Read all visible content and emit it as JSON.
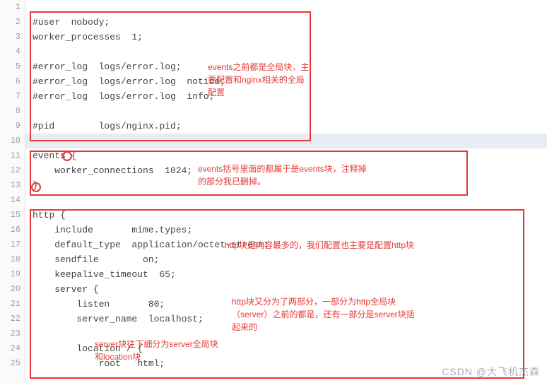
{
  "code_lines": [
    {
      "n": 1,
      "text": "",
      "hl": false
    },
    {
      "n": 2,
      "text": "#user  nobody;",
      "hl": false
    },
    {
      "n": 3,
      "text": "worker_processes  1;",
      "hl": false
    },
    {
      "n": 4,
      "text": "",
      "hl": false
    },
    {
      "n": 5,
      "text": "#error_log  logs/error.log;",
      "hl": false
    },
    {
      "n": 6,
      "text": "#error_log  logs/error.log  notice;",
      "hl": false
    },
    {
      "n": 7,
      "text": "#error_log  logs/error.log  info;",
      "hl": false
    },
    {
      "n": 8,
      "text": "",
      "hl": false
    },
    {
      "n": 9,
      "text": "#pid        logs/nginx.pid;",
      "hl": false
    },
    {
      "n": 10,
      "text": "",
      "hl": true
    },
    {
      "n": 11,
      "text": "events {",
      "hl": false
    },
    {
      "n": 12,
      "text": "    worker_connections  1024;",
      "hl": false
    },
    {
      "n": 13,
      "text": "}",
      "hl": false
    },
    {
      "n": 14,
      "text": "",
      "hl": false
    },
    {
      "n": 15,
      "text": "http {",
      "hl": false
    },
    {
      "n": 16,
      "text": "    include       mime.types;",
      "hl": false
    },
    {
      "n": 17,
      "text": "    default_type  application/octet-stream;",
      "hl": false
    },
    {
      "n": 18,
      "text": "    sendfile        on;",
      "hl": false
    },
    {
      "n": 19,
      "text": "    keepalive_timeout  65;",
      "hl": false
    },
    {
      "n": 20,
      "text": "    server {",
      "hl": false
    },
    {
      "n": 21,
      "text": "        listen       80;",
      "hl": false
    },
    {
      "n": 22,
      "text": "        server_name  localhost;",
      "hl": false
    },
    {
      "n": 23,
      "text": "",
      "hl": false
    },
    {
      "n": 24,
      "text": "        location / {",
      "hl": false
    },
    {
      "n": 25,
      "text": "            root   html;",
      "hl": false
    }
  ],
  "annotations": {
    "global_block": "events之前都是全局块，主要配置和nginx相关的全局配置",
    "events_block": "events括号里面的都属于是events块，注释掉的部分我已删掉。",
    "http_block": "http块是内容最多的，我们配置也主要是配置http块",
    "http_parts": "http块又分为了两部分，一部分为http全局块（server）之前的都是，还有一部分是server块括起来的",
    "server_block": "server块往下细分为server全局块和location块"
  },
  "watermark": "CSDN @大飞机杰森"
}
